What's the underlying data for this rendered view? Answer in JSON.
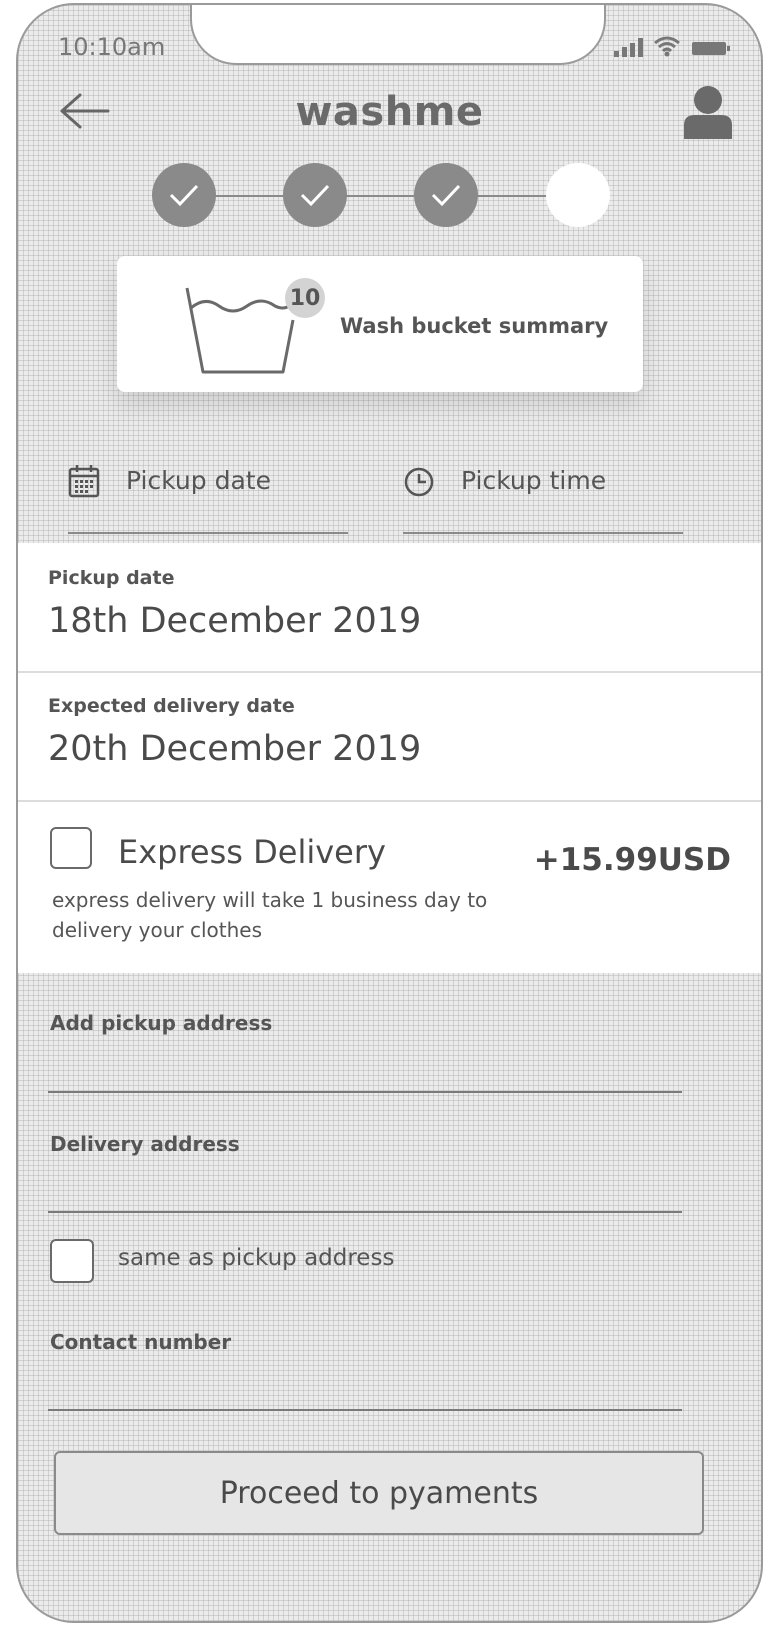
{
  "status_bar": {
    "time": "10:10am"
  },
  "header": {
    "logo": "washme"
  },
  "stepper": {
    "steps": [
      {
        "state": "completed"
      },
      {
        "state": "completed"
      },
      {
        "state": "completed"
      },
      {
        "state": "pending"
      }
    ]
  },
  "summary": {
    "count": "10",
    "label": "Wash bucket summary"
  },
  "pickers": {
    "date_label": "Pickup date",
    "time_label": "Pickup time"
  },
  "pickup": {
    "label": "Pickup date",
    "value": "18th December 2019"
  },
  "delivery": {
    "label": "Expected delivery date",
    "value": "20th December 2019"
  },
  "express": {
    "title": "Express Delivery",
    "price": "+15.99USD",
    "description": "express delivery will take 1 business day to delivery your clothes",
    "checked": false
  },
  "form": {
    "pickup_address_label": "Add pickup address",
    "delivery_address_label": "Delivery address",
    "same_as_pickup_label": "same as pickup address",
    "contact_label": "Contact number"
  },
  "actions": {
    "proceed_label": "Proceed to pyaments"
  },
  "colors": {
    "step_done": "#8a8a8a",
    "panel": "#ffffff",
    "button_bg": "#e6e6e6"
  },
  "icons": [
    "back-arrow-icon",
    "user-icon",
    "check-icon",
    "wash-bucket-icon",
    "calendar-icon",
    "clock-icon",
    "signal-icon",
    "wifi-icon",
    "battery-icon"
  ]
}
